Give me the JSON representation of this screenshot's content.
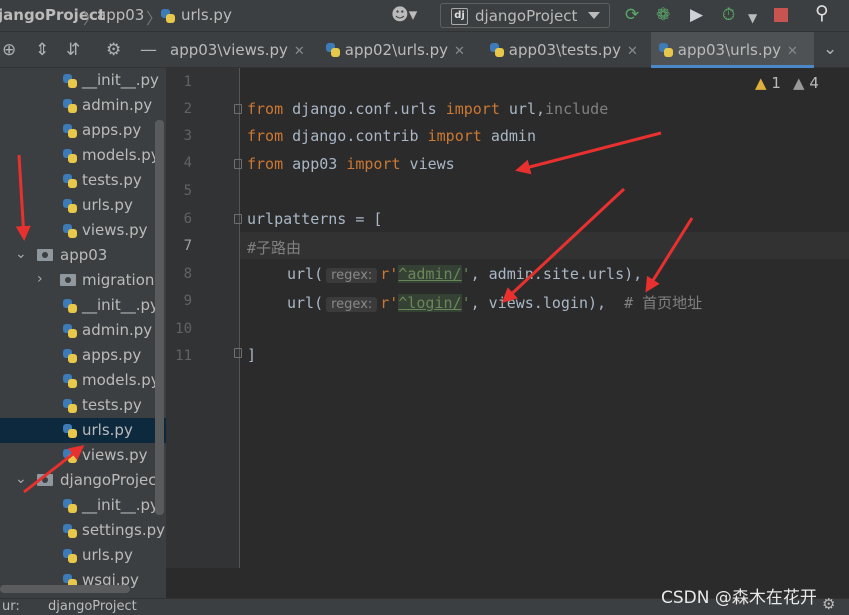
{
  "breadcrumb": {
    "project": "jangoProject",
    "folder": "app03",
    "file": "urls.py"
  },
  "run_config": {
    "label": "djangoProject",
    "icon_text": "dj"
  },
  "toolbar_icons": [
    "person-icon",
    "rerun-icon",
    "debug-icon",
    "coverage-icon",
    "profile-icon",
    "stop-icon",
    "search-icon"
  ],
  "tabs": [
    {
      "label": "app03\\views.py",
      "active": false
    },
    {
      "label": "app02\\urls.py",
      "active": false
    },
    {
      "label": "app03\\tests.py",
      "active": false
    },
    {
      "label": "app03\\urls.py",
      "active": true
    }
  ],
  "tree": [
    {
      "label": "__init__.py",
      "kind": "py"
    },
    {
      "label": "admin.py",
      "kind": "py"
    },
    {
      "label": "apps.py",
      "kind": "py"
    },
    {
      "label": "models.py",
      "kind": "py"
    },
    {
      "label": "tests.py",
      "kind": "py"
    },
    {
      "label": "urls.py",
      "kind": "py"
    },
    {
      "label": "views.py",
      "kind": "py"
    },
    {
      "label": "app03",
      "kind": "folder-open"
    },
    {
      "label": "migrations",
      "kind": "folder-closed"
    },
    {
      "label": "__init__.py",
      "kind": "py"
    },
    {
      "label": "admin.py",
      "kind": "py"
    },
    {
      "label": "apps.py",
      "kind": "py"
    },
    {
      "label": "models.py",
      "kind": "py"
    },
    {
      "label": "tests.py",
      "kind": "py"
    },
    {
      "label": "urls.py",
      "kind": "py",
      "selected": true
    },
    {
      "label": "views.py",
      "kind": "py"
    },
    {
      "label": "djangoProject",
      "kind": "folder-open"
    },
    {
      "label": "__init__.py",
      "kind": "py"
    },
    {
      "label": "settings.py",
      "kind": "py"
    },
    {
      "label": "urls.py",
      "kind": "py"
    },
    {
      "label": "wsgi.py",
      "kind": "py"
    }
  ],
  "line_numbers": [
    "1",
    "2",
    "3",
    "4",
    "5",
    "6",
    "7",
    "8",
    "9",
    "10",
    "11"
  ],
  "code": {
    "l2_from": "from",
    "l2_mod": " django.conf.urls ",
    "l2_import": "import",
    "l2_names": " url",
    "l2_comma": ",",
    "l2_inc": "include",
    "l3_from": "from",
    "l3_mod": " django.contrib ",
    "l3_import": "import",
    "l3_names": " admin",
    "l4_from": "from",
    "l4_mod": " app03 ",
    "l4_import": "import",
    "l4_names": " views",
    "l6": "urlpatterns = [",
    "l7": "#子路由",
    "l8_a": "url(",
    "l8_hint": "regex:",
    "l8_r": "r'",
    "l8_pat": "^admin/",
    "l8_q": "'",
    "l8_b": ", admin.site.urls),",
    "l9_a": "url(",
    "l9_hint": "regex:",
    "l9_r": "r'",
    "l9_pat": "^login/",
    "l9_q": "'",
    "l9_b": ", views.login),",
    "l9_cmt": "  # 首页地址",
    "l11": "]"
  },
  "inspections": {
    "warnings": "1",
    "weak_warnings": "4"
  },
  "bottom": {
    "left_text": "ur:",
    "run_label": "djangoProject"
  },
  "watermark": "CSDN @森木在花开",
  "colors": {
    "keyword": "#cc7832",
    "string": "#6a8759",
    "comment": "#808080",
    "annotation_arrow": "#e8312f"
  }
}
